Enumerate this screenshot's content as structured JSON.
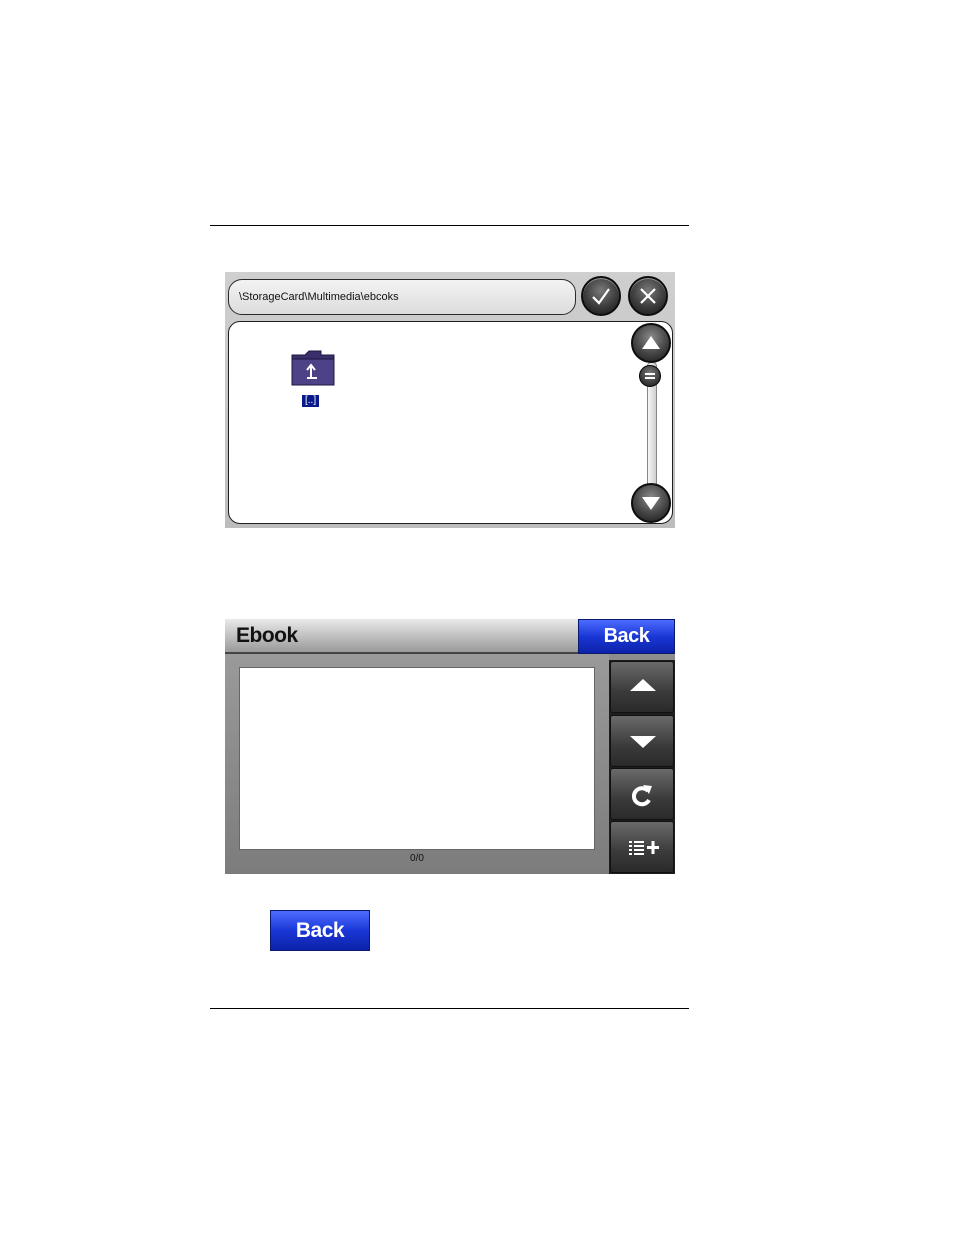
{
  "file_browser": {
    "path": "\\StorageCard\\Multimedia\\ebcoks",
    "ok_icon": "checkmark-icon",
    "cancel_icon": "close-icon",
    "folder_label": "[..]",
    "folder_icon": "folder-up-icon",
    "scroll_up_icon": "triangle-up-icon",
    "scroll_down_icon": "triangle-down-icon"
  },
  "ebook": {
    "title": "Ebook",
    "back_label": "Back",
    "page_count": "0/0",
    "buttons": [
      {
        "icon": "arrow-up-icon"
      },
      {
        "icon": "arrow-down-icon"
      },
      {
        "icon": "rotate-icon"
      },
      {
        "icon": "add-list-icon"
      }
    ]
  },
  "standalone_back": {
    "label": "Back"
  },
  "colors": {
    "accent_blue": "#1a37d6",
    "folder_label_bg": "#0a1a8a"
  }
}
